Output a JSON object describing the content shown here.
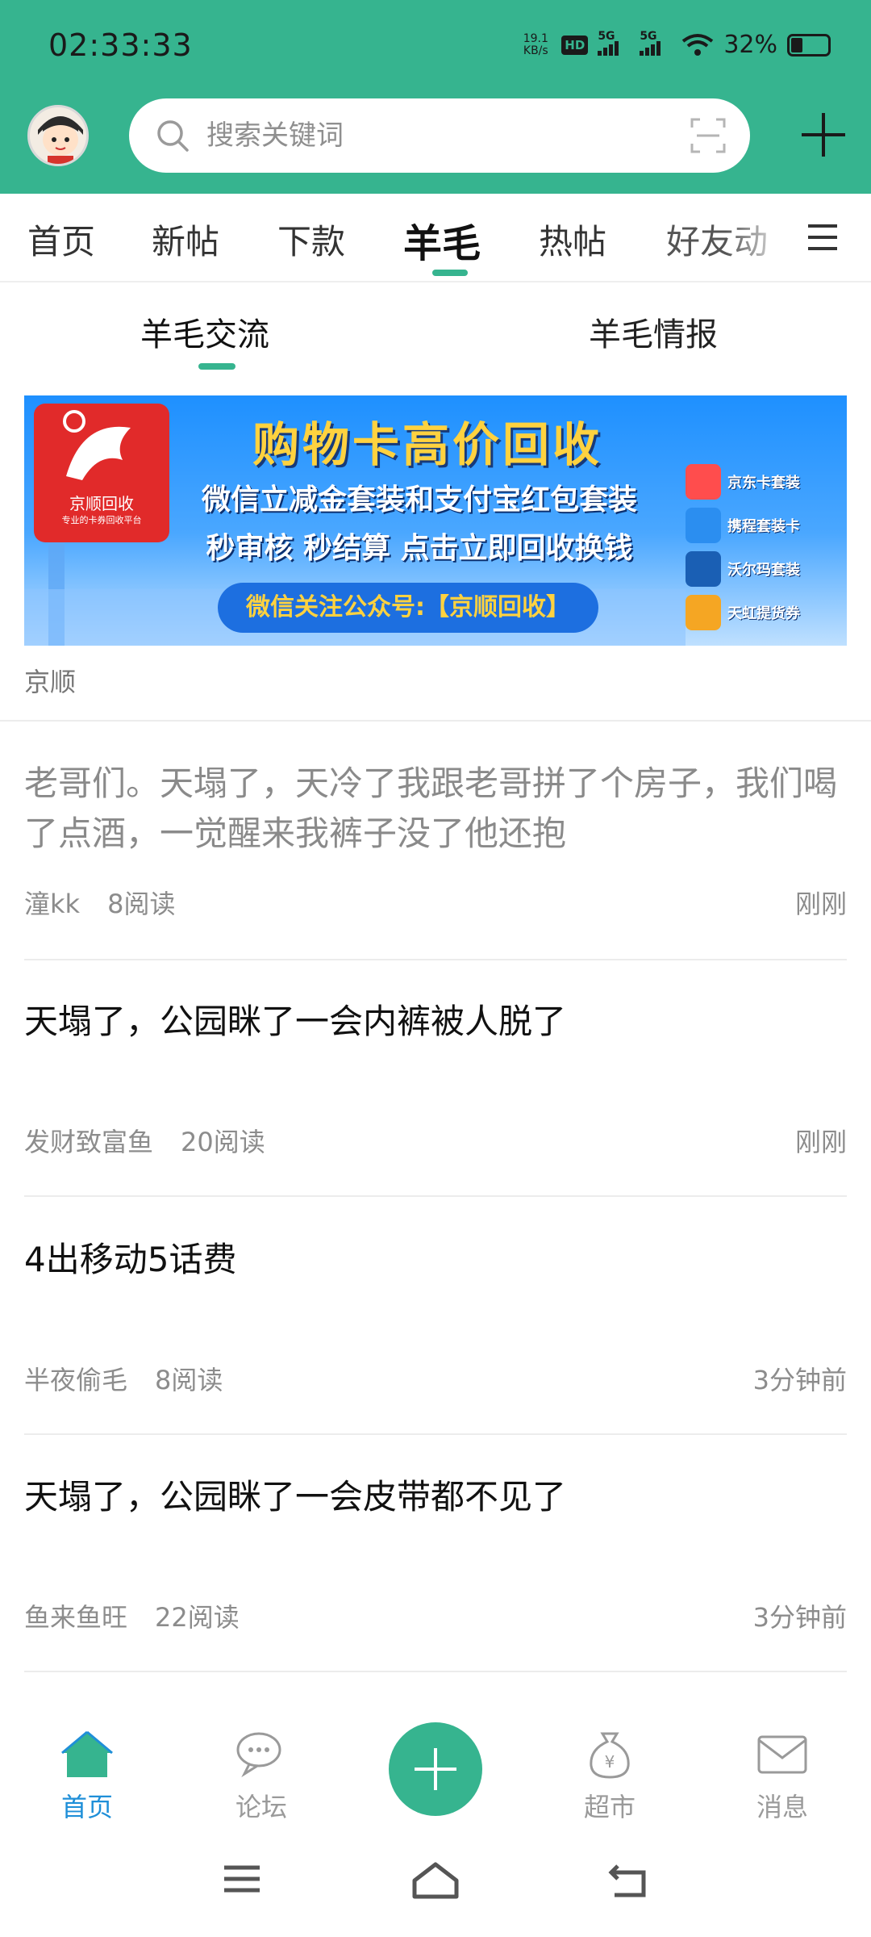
{
  "status_bar": {
    "time": "02:33:33",
    "net_speed_value": "19.1",
    "net_speed_unit": "KB/s",
    "hd_badge": "HD",
    "signal1": "5G",
    "signal2": "5G",
    "battery_percent": "32%"
  },
  "header": {
    "search_placeholder": "搜索关键词",
    "accent_color": "#36b48f"
  },
  "channel_tabs": [
    {
      "label": "首页",
      "active": false
    },
    {
      "label": "新帖",
      "active": false
    },
    {
      "label": "下款",
      "active": false
    },
    {
      "label": "羊毛",
      "active": true
    },
    {
      "label": "热帖",
      "active": false
    },
    {
      "label": "好友动",
      "active": false
    }
  ],
  "sub_tabs": [
    {
      "label": "羊毛交流",
      "active": true
    },
    {
      "label": "羊毛情报",
      "active": false
    }
  ],
  "banner": {
    "logo_name": "京顺回收",
    "logo_slogan": "专业的卡券回收平台",
    "headline": "购物卡高价回收",
    "line2": "微信立减金套装和支付宝红包套装",
    "line3": "秒审核 秒结算 点击立即回收换钱",
    "cta": "微信关注公众号:【京顺回收】",
    "side_items": [
      "京东卡套装",
      "携程套装卡",
      "沃尔玛套装",
      "天虹提货券"
    ],
    "sponsor": "京顺"
  },
  "posts": [
    {
      "title": "老哥们。天塌了，天冷了我跟老哥拼了个房子，我们喝了点酒，一觉醒来我裤子没了他还抱",
      "author": "潼kk",
      "reads": "8阅读",
      "time": "刚刚",
      "read": true
    },
    {
      "title": "天塌了，公园眯了一会内裤被人脱了",
      "author": "发财致富鱼",
      "reads": "20阅读",
      "time": "刚刚",
      "read": false
    },
    {
      "title": "4出移动5话费",
      "author": "半夜偷毛",
      "reads": "8阅读",
      "time": "3分钟前",
      "read": false
    },
    {
      "title": "天塌了，公园眯了一会皮带都不见了",
      "author": "鱼来鱼旺",
      "reads": "22阅读",
      "time": "3分钟前",
      "read": false
    }
  ],
  "bottom_nav": [
    {
      "label": "首页",
      "icon": "home-icon",
      "active": true
    },
    {
      "label": "论坛",
      "icon": "chat-bubble-icon",
      "active": false
    },
    {
      "label": "",
      "icon": "plus-icon",
      "active": false
    },
    {
      "label": "超市",
      "icon": "money-bag-icon",
      "active": false
    },
    {
      "label": "消息",
      "icon": "envelope-icon",
      "active": false
    }
  ],
  "colors": {
    "accent": "#36b48f",
    "nav_active": "#1f8fd8",
    "muted_text": "#8c8c8c"
  }
}
